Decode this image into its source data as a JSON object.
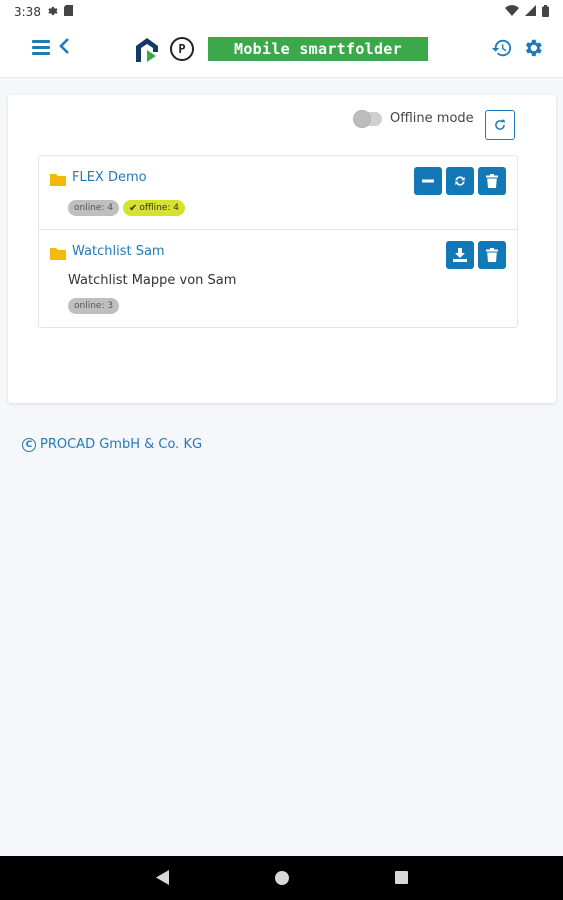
{
  "status_bar": {
    "time": "3:38"
  },
  "app_bar": {
    "p_badge": "P",
    "title": "Mobile smartfolder"
  },
  "toolbar": {
    "offline_mode_label": "Offline mode",
    "offline_mode_enabled": false
  },
  "folders": [
    {
      "name": "FLEX Demo",
      "description": "",
      "badges": [
        {
          "label": "online: 4",
          "style": "gray"
        },
        {
          "label": "offline: 4",
          "style": "yellow",
          "check": true
        }
      ],
      "actions": [
        "remove-offline",
        "sync",
        "delete"
      ]
    },
    {
      "name": "Watchlist Sam",
      "description": "Watchlist Mappe von Sam",
      "badges": [
        {
          "label": "online: 3",
          "style": "gray"
        }
      ],
      "actions": [
        "download",
        "delete"
      ]
    }
  ],
  "footer": {
    "copyright_symbol": "C",
    "copyright_text": "PROCAD GmbH & Co. KG"
  },
  "colors": {
    "accent": "#1f7ab9",
    "button": "#1378b6",
    "title_bg": "#3ba94b",
    "offline_badge": "#d6e22e",
    "online_badge": "#bfbfbf"
  }
}
